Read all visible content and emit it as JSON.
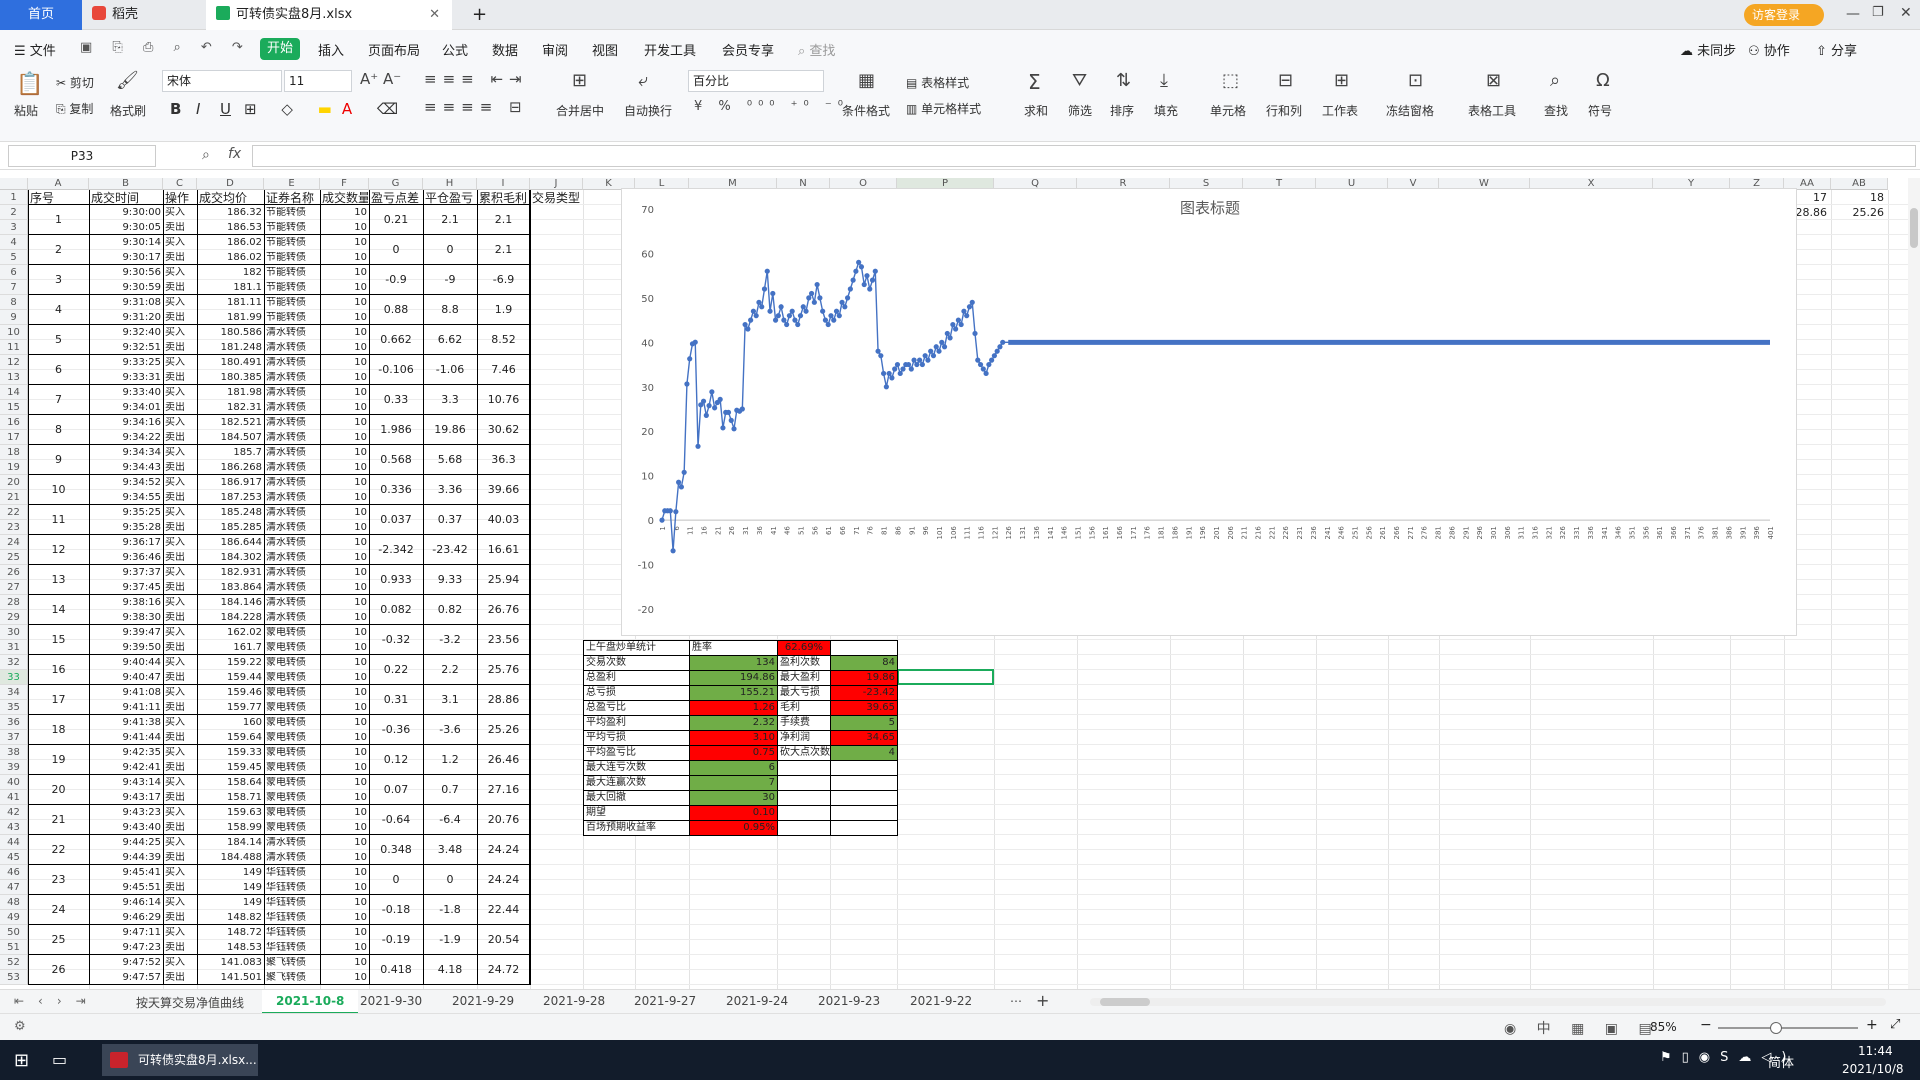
{
  "tabs": {
    "home": "首页",
    "daoke": "稻壳",
    "file": "可转债实盘8月.xlsx",
    "new": "+",
    "guest": "访客登录"
  },
  "menu": {
    "file": "文件",
    "start": "开始",
    "insert": "插入",
    "layout": "页面布局",
    "formula": "公式",
    "data": "数据",
    "review": "审阅",
    "view": "视图",
    "dev": "开发工具",
    "member": "会员专享",
    "search": "查找",
    "unsynced": "未同步",
    "collab": "协作",
    "share": "分享"
  },
  "ribbon": {
    "paste": "粘贴",
    "cut": "剪切",
    "copy": "复制",
    "format_painter": "格式刷",
    "font": "宋体",
    "size": "11",
    "number_format": "百分比",
    "merge": "合并居中",
    "wrap": "自动换行",
    "cond_format": "条件格式",
    "table_style": "表格样式",
    "cell_style": "单元格样式",
    "sum": "求和",
    "filter": "筛选",
    "sort": "排序",
    "fill": "填充",
    "cell": "单元格",
    "rowcol": "行和列",
    "sheet": "工作表",
    "freeze": "冻结窗格",
    "table_tools": "表格工具",
    "find": "查找",
    "symbol": "符号",
    "bold": "B",
    "italic": "I",
    "underline": "U"
  },
  "formula_bar": {
    "name_box": "P33",
    "fx": "fx",
    "value": ""
  },
  "columns": [
    "A",
    "B",
    "C",
    "D",
    "E",
    "F",
    "G",
    "H",
    "I",
    "J",
    "K",
    "L",
    "M",
    "N",
    "O",
    "P",
    "Q",
    "R",
    "S",
    "T",
    "U",
    "V",
    "W",
    "X",
    "Y",
    "Z",
    "AA",
    "AB",
    "AC"
  ],
  "headers": [
    "序号",
    "成交时间",
    "操作",
    "成交均价",
    "证券名称",
    "成交数量",
    "盈亏点差",
    "平仓盈亏",
    "累积毛利",
    "交易类型"
  ],
  "side_values": {
    "ab1": "17",
    "ac1": "18",
    "ab2": "28.86",
    "ac2": "25.26"
  },
  "trades": [
    [
      "9:30:00",
      "买入",
      "186.32",
      "节能转债",
      "10"
    ],
    [
      "9:30:05",
      "卖出",
      "186.53",
      "节能转债",
      "10"
    ],
    [
      "9:30:14",
      "买入",
      "186.02",
      "节能转债",
      "10"
    ],
    [
      "9:30:17",
      "卖出",
      "186.02",
      "节能转债",
      "10"
    ],
    [
      "9:30:56",
      "买入",
      "182",
      "节能转债",
      "10"
    ],
    [
      "9:30:59",
      "卖出",
      "181.1",
      "节能转债",
      "10"
    ],
    [
      "9:31:08",
      "买入",
      "181.11",
      "节能转债",
      "10"
    ],
    [
      "9:31:20",
      "卖出",
      "181.99",
      "节能转债",
      "10"
    ],
    [
      "9:32:40",
      "买入",
      "180.586",
      "清水转债",
      "10"
    ],
    [
      "9:32:51",
      "卖出",
      "181.248",
      "清水转债",
      "10"
    ],
    [
      "9:33:25",
      "买入",
      "180.491",
      "清水转债",
      "10"
    ],
    [
      "9:33:31",
      "卖出",
      "180.385",
      "清水转债",
      "10"
    ],
    [
      "9:33:40",
      "买入",
      "181.98",
      "清水转债",
      "10"
    ],
    [
      "9:34:01",
      "卖出",
      "182.31",
      "清水转债",
      "10"
    ],
    [
      "9:34:16",
      "买入",
      "182.521",
      "清水转债",
      "10"
    ],
    [
      "9:34:22",
      "卖出",
      "184.507",
      "清水转债",
      "10"
    ],
    [
      "9:34:34",
      "买入",
      "185.7",
      "清水转债",
      "10"
    ],
    [
      "9:34:43",
      "卖出",
      "186.268",
      "清水转债",
      "10"
    ],
    [
      "9:34:52",
      "买入",
      "186.917",
      "清水转债",
      "10"
    ],
    [
      "9:34:55",
      "卖出",
      "187.253",
      "清水转债",
      "10"
    ],
    [
      "9:35:25",
      "买入",
      "185.248",
      "清水转债",
      "10"
    ],
    [
      "9:35:28",
      "卖出",
      "185.285",
      "清水转债",
      "10"
    ],
    [
      "9:36:17",
      "买入",
      "186.644",
      "清水转债",
      "10"
    ],
    [
      "9:36:46",
      "卖出",
      "184.302",
      "清水转债",
      "10"
    ],
    [
      "9:37:37",
      "买入",
      "182.931",
      "清水转债",
      "10"
    ],
    [
      "9:37:45",
      "卖出",
      "183.864",
      "清水转债",
      "10"
    ],
    [
      "9:38:16",
      "买入",
      "184.146",
      "清水转债",
      "10"
    ],
    [
      "9:38:30",
      "卖出",
      "184.228",
      "清水转债",
      "10"
    ],
    [
      "9:39:47",
      "买入",
      "162.02",
      "蒙电转债",
      "10"
    ],
    [
      "9:39:50",
      "卖出",
      "161.7",
      "蒙电转债",
      "10"
    ],
    [
      "9:40:44",
      "买入",
      "159.22",
      "蒙电转债",
      "10"
    ],
    [
      "9:40:47",
      "卖出",
      "159.44",
      "蒙电转债",
      "10"
    ],
    [
      "9:41:08",
      "买入",
      "159.46",
      "蒙电转债",
      "10"
    ],
    [
      "9:41:11",
      "卖出",
      "159.77",
      "蒙电转债",
      "10"
    ],
    [
      "9:41:38",
      "买入",
      "160",
      "蒙电转债",
      "10"
    ],
    [
      "9:41:44",
      "卖出",
      "159.64",
      "蒙电转债",
      "10"
    ],
    [
      "9:42:35",
      "买入",
      "159.33",
      "蒙电转债",
      "10"
    ],
    [
      "9:42:41",
      "卖出",
      "159.45",
      "蒙电转债",
      "10"
    ],
    [
      "9:43:14",
      "买入",
      "158.64",
      "蒙电转债",
      "10"
    ],
    [
      "9:43:17",
      "卖出",
      "158.71",
      "蒙电转债",
      "10"
    ],
    [
      "9:43:23",
      "买入",
      "159.63",
      "蒙电转债",
      "10"
    ],
    [
      "9:43:40",
      "卖出",
      "158.99",
      "蒙电转债",
      "10"
    ],
    [
      "9:44:25",
      "买入",
      "184.14",
      "清水转债",
      "10"
    ],
    [
      "9:44:39",
      "卖出",
      "184.488",
      "清水转债",
      "10"
    ],
    [
      "9:45:41",
      "买入",
      "149",
      "华钰转债",
      "10"
    ],
    [
      "9:45:51",
      "卖出",
      "149",
      "华钰转债",
      "10"
    ],
    [
      "9:46:14",
      "买入",
      "149",
      "华钰转债",
      "10"
    ],
    [
      "9:46:29",
      "卖出",
      "148.82",
      "华钰转债",
      "10"
    ],
    [
      "9:47:11",
      "买入",
      "148.72",
      "华钰转债",
      "10"
    ],
    [
      "9:47:23",
      "卖出",
      "148.53",
      "华钰转债",
      "10"
    ],
    [
      "9:47:52",
      "买入",
      "141.083",
      "聚飞转债",
      "10"
    ],
    [
      "9:47:57",
      "卖出",
      "141.501",
      "聚飞转债",
      "10"
    ]
  ],
  "pairs": [
    [
      "1",
      "0.21",
      "2.1",
      "2.1"
    ],
    [
      "2",
      "0",
      "0",
      "2.1"
    ],
    [
      "3",
      "-0.9",
      "-9",
      "-6.9"
    ],
    [
      "4",
      "0.88",
      "8.8",
      "1.9"
    ],
    [
      "5",
      "0.662",
      "6.62",
      "8.52"
    ],
    [
      "6",
      "-0.106",
      "-1.06",
      "7.46"
    ],
    [
      "7",
      "0.33",
      "3.3",
      "10.76"
    ],
    [
      "8",
      "1.986",
      "19.86",
      "30.62"
    ],
    [
      "9",
      "0.568",
      "5.68",
      "36.3"
    ],
    [
      "10",
      "0.336",
      "3.36",
      "39.66"
    ],
    [
      "11",
      "0.037",
      "0.37",
      "40.03"
    ],
    [
      "12",
      "-2.342",
      "-23.42",
      "16.61"
    ],
    [
      "13",
      "0.933",
      "9.33",
      "25.94"
    ],
    [
      "14",
      "0.082",
      "0.82",
      "26.76"
    ],
    [
      "15",
      "-0.32",
      "-3.2",
      "23.56"
    ],
    [
      "16",
      "0.22",
      "2.2",
      "25.76"
    ],
    [
      "17",
      "0.31",
      "3.1",
      "28.86"
    ],
    [
      "18",
      "-0.36",
      "-3.6",
      "25.26"
    ],
    [
      "19",
      "0.12",
      "1.2",
      "26.46"
    ],
    [
      "20",
      "0.07",
      "0.7",
      "27.16"
    ],
    [
      "21",
      "-0.64",
      "-6.4",
      "20.76"
    ],
    [
      "22",
      "0.348",
      "3.48",
      "24.24"
    ],
    [
      "23",
      "0",
      "0",
      "24.24"
    ],
    [
      "24",
      "-0.18",
      "-1.8",
      "22.44"
    ],
    [
      "25",
      "-0.19",
      "-1.9",
      "20.54"
    ],
    [
      "26",
      "0.418",
      "4.18",
      "24.72"
    ]
  ],
  "stats": {
    "title": "上午盘炒单统计",
    "win_rate_label": "胜率",
    "win_rate": "62.69%",
    "rows": [
      [
        "交易次数",
        "134",
        "盈利次数",
        "84"
      ],
      [
        "总盈利",
        "194.86",
        "最大盈利",
        "19.86"
      ],
      [
        "总亏损",
        "155.21",
        "最大亏损",
        "-23.42"
      ],
      [
        "总盈亏比",
        "1.26",
        "毛利",
        "39.65"
      ],
      [
        "平均盈利",
        "2.32",
        "手续费",
        "5"
      ],
      [
        "平均亏损",
        "3.10",
        "净利润",
        "34.65"
      ],
      [
        "平均盈亏比",
        "0.75",
        "砍大点次数",
        "4"
      ],
      [
        "最大连亏次数",
        "6",
        "",
        ""
      ],
      [
        "最大连赢次数",
        "7",
        "",
        ""
      ],
      [
        "最大回撤",
        "30",
        "",
        ""
      ],
      [
        "期望",
        "0.10",
        "",
        ""
      ],
      [
        "百场预期收益率",
        "0.95%",
        "",
        ""
      ]
    ]
  },
  "sheet_tabs": [
    "按天算交易净值曲线",
    "2021-10-8",
    "2021-9-30",
    "2021-9-29",
    "2021-9-28",
    "2021-9-27",
    "2021-9-24",
    "2021-9-23",
    "2021-9-22"
  ],
  "status": {
    "zoom": "85%",
    "time": "11:44",
    "date": "2021/10/8",
    "ime": "简体",
    "taskbar_app": "可转债实盘8月.xlsx..."
  },
  "colors": {
    "green": "#70ad47",
    "red": "#ff0000",
    "series": "#4472c4",
    "accent": "#1bab5b",
    "guest": "#f5a623"
  },
  "chart_data": {
    "type": "line",
    "title": "图表标题",
    "ylim": [
      -20,
      70
    ],
    "yticks": [
      -20,
      -10,
      0,
      10,
      20,
      30,
      40,
      50,
      60,
      70
    ],
    "x_start": 1,
    "x_end": 401,
    "x_step": 5,
    "series": [
      {
        "values": [
          0,
          2.1,
          2.1,
          2.1,
          -6.9,
          1.9,
          8.52,
          7.46,
          10.76,
          30.62,
          36.3,
          39.66,
          40.03,
          16.61,
          25.94,
          26.76,
          23.56,
          25.76,
          28.86,
          25.26,
          26.46,
          27.16,
          20.76,
          24.24,
          24.24,
          22.44,
          20.54,
          24.72,
          24.5,
          25,
          44,
          43,
          45,
          47,
          46,
          49,
          48,
          52,
          56,
          47,
          51,
          45,
          46,
          48,
          45,
          44,
          46,
          47,
          45,
          44,
          46,
          48,
          47,
          50,
          51,
          49,
          53,
          50,
          47,
          45,
          44,
          46,
          45,
          47,
          46,
          49,
          48,
          50,
          52,
          54,
          56,
          58,
          57,
          53,
          55,
          52,
          54,
          56,
          38,
          37,
          33,
          30,
          33,
          32,
          34,
          35,
          33,
          34,
          35,
          35,
          34,
          36,
          35,
          36,
          35,
          37,
          36,
          38,
          37,
          39,
          38,
          40,
          39,
          42,
          41,
          44,
          43,
          45,
          44,
          47,
          46,
          48,
          49,
          42,
          36,
          35,
          34,
          33,
          35,
          36,
          37,
          38,
          39,
          40
        ]
      }
    ],
    "flat_value": 40,
    "flat_to": 401
  }
}
